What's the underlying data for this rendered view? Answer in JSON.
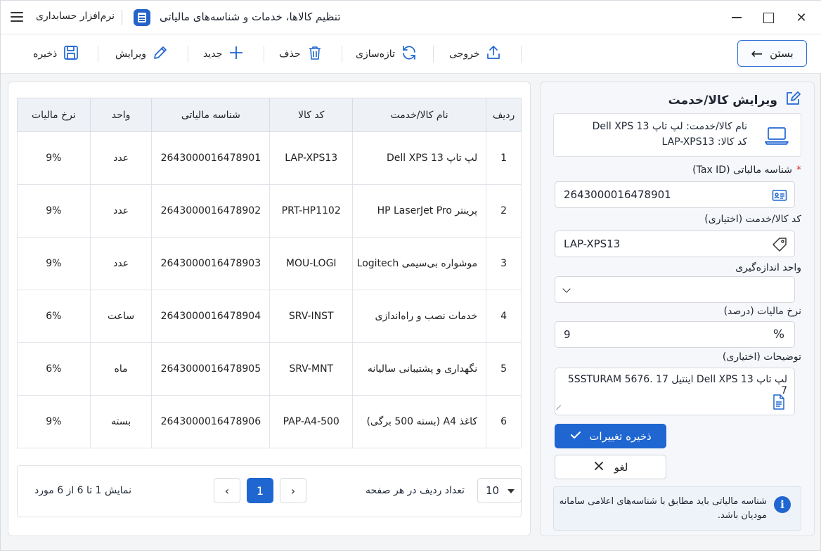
{
  "window": {
    "app_name": "نرم‌افزار حسابداری",
    "title": "تنظیم کالاها، خدمات و شناسه‌های مالیاتی",
    "close_glyph": "✕"
  },
  "toolbar": {
    "save": "ذخیره",
    "edit": "ویرایش",
    "new": "جدید",
    "delete": "حذف",
    "refresh": "تازه‌سازی",
    "export": "خروجی",
    "close": "بستن",
    "close_arrow": "←"
  },
  "table": {
    "headers": {
      "row": "ردیف",
      "name": "نام کالا/خدمت",
      "code": "کد کالا",
      "tax_id": "شناسه مالیاتی",
      "unit": "واحد",
      "rate": "نرخ مالیات"
    },
    "rows": [
      {
        "row": "1",
        "name": "لپ تاپ Dell XPS 13",
        "code": "LAP-XPS13",
        "tax_id": "2643000016478901",
        "unit": "عدد",
        "rate": "9%"
      },
      {
        "row": "2",
        "name": "پرینتر HP LaserJet Pro",
        "code": "PRT-HP1102",
        "tax_id": "2643000016478902",
        "unit": "عدد",
        "rate": "9%"
      },
      {
        "row": "3",
        "name": "موشواره بی‌سیمی Logitech",
        "code": "MOU-LOGI",
        "tax_id": "2643000016478903",
        "unit": "عدد",
        "rate": "9%"
      },
      {
        "row": "4",
        "name": "خدمات نصب و راه‌اندازی",
        "code": "SRV-INST",
        "tax_id": "2643000016478904",
        "unit": "ساعت",
        "rate": "6%"
      },
      {
        "row": "5",
        "name": "نگهداری و پشتیبانی سالیانه",
        "code": "SRV-MNT",
        "tax_id": "2643000016478905",
        "unit": "ماه",
        "rate": "6%"
      },
      {
        "row": "6",
        "name": "کاغذ A4 (بسته 500 برگی)",
        "code": "PAP-A4-500",
        "tax_id": "2643000016478906",
        "unit": "بسته",
        "rate": "9%"
      }
    ]
  },
  "pagination": {
    "info": "نمایش 1 تا 6 از 6 مورد",
    "prev": "‹",
    "next": "›",
    "current_page": "1",
    "page_size_label": "تعداد ردیف در هر صفحه",
    "page_size": "10"
  },
  "edit_panel": {
    "title": "ویرایش کالا/خدمت",
    "item_name_line": "نام کالا/خدمت: لپ تاپ Dell XPS 13",
    "item_code_line": "کد کالا: LAP-XPS13",
    "tax_id_label": "شناسه مالیاتی (Tax ID)",
    "required_mark": "*",
    "tax_id_value": "2643000016478901",
    "code_label": "کد کالا/خدمت (اختیاری)",
    "code_value": "LAP-XPS13",
    "unit_label": "واحد اندازه‌گیری",
    "unit_value": "",
    "rate_label": "نرخ مالیات (درصد)",
    "rate_value": "9",
    "rate_suffix": "%",
    "notes_label": "توضیحات (اختیاری)",
    "notes_value": "لپ تاپ Dell XPS 13 اینتیل 17 .5SSTURAM 5676 7",
    "save_button": "ذخیره تغییرات",
    "cancel_button": "لغو",
    "info_text": "شناسه مالیاتی باید مطابق با شناسه‌های اعلامی سامانه مودیان باشد."
  },
  "colors": {
    "primary": "#1f66d1",
    "rate_9": "#1f58c9",
    "rate_6": "#1b8a80",
    "required": "#d32f2f"
  }
}
